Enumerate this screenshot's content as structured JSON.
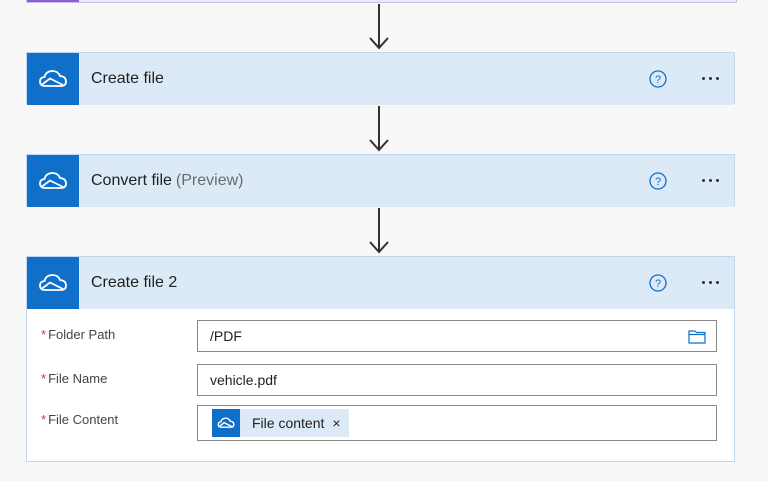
{
  "cards": [
    {
      "title": "Create file",
      "subtitle": "",
      "help_symbol": "?"
    },
    {
      "title": "Convert file",
      "subtitle": "(Preview)",
      "help_symbol": "?"
    },
    {
      "title": "Create file 2",
      "subtitle": "",
      "help_symbol": "?"
    }
  ],
  "form": {
    "required_marker": "*",
    "folder_path": {
      "label": "Folder Path",
      "value": "/PDF"
    },
    "file_name": {
      "label": "File Name",
      "value": "vehicle.pdf"
    },
    "file_content": {
      "label": "File Content",
      "token_label": "File content",
      "token_remove": "×"
    }
  },
  "icons": {
    "connector": "onedrive-cloud-icon",
    "help": "help-circle-icon",
    "more": "more-horizontal-icon",
    "folder": "folder-icon",
    "arrow": "arrow-down-icon"
  },
  "colors": {
    "accent": "#0f6fc9",
    "card_header": "#dce9f7",
    "required": "#d13438",
    "prev_step_accent": "#8a5cd8"
  }
}
